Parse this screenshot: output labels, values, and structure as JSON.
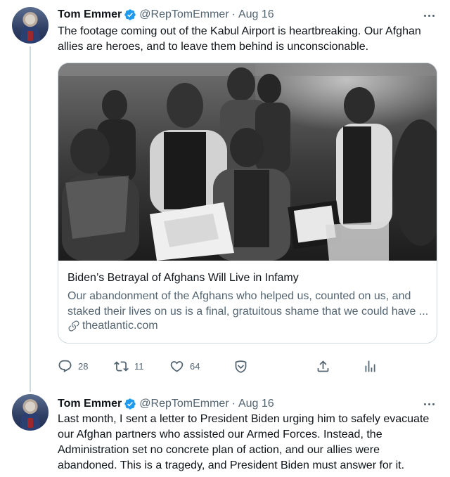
{
  "tweets": [
    {
      "author": {
        "name": "Tom Emmer",
        "handle": "@RepTomEmmer",
        "verified": true,
        "avatar_icon": "profile-photo"
      },
      "separator": "·",
      "date": "Aug 16",
      "text": "The footage coming out of the Kabul Airport is heartbreaking. Our Afghan allies are heroes, and to leave them behind is unconscionable.",
      "card": {
        "image_alt": "photo-of-afghan-men-around-documents",
        "title": "Biden’s Betrayal of Afghans Will Live in Infamy",
        "description": "Our abandonment of the Afghans who helped us, counted on us, and staked their lives on us is a final, gratuitous shame that we could have ...",
        "domain": "theatlantic.com"
      },
      "actions": {
        "replies": "28",
        "retweets": "11",
        "likes": "64"
      }
    },
    {
      "author": {
        "name": "Tom Emmer",
        "handle": "@RepTomEmmer",
        "verified": true,
        "avatar_icon": "profile-photo"
      },
      "separator": "·",
      "date": "Aug 16",
      "text": "Last month, I sent a letter to President Biden urging him to safely evacuate our Afghan partners who assisted our Armed Forces. Instead, the Administration set no concrete plan of action, and our allies were abandoned. This is a tragedy, and President Biden must answer for it."
    }
  ],
  "colors": {
    "text_primary": "#0f1419",
    "text_secondary": "#536471",
    "verified_blue": "#1d9bf0",
    "border": "#cfd9de"
  }
}
